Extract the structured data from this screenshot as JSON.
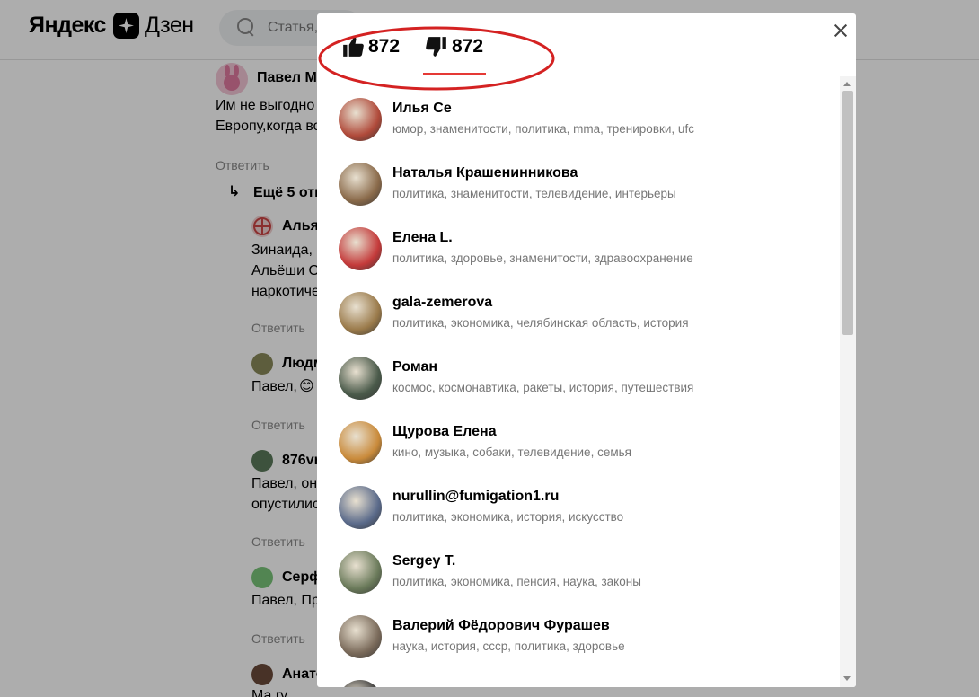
{
  "header": {
    "logo_part1": "Яндекс",
    "logo_part2": "Дзен",
    "search_placeholder": "Статья,"
  },
  "comments": {
    "c1_author": "Павел Мі",
    "c1_text_line1": "Им не выгодно",
    "c1_text_line2": "Европу,когда во",
    "c1_reply": "Ответить",
    "more_replies": "Ещё 5 отв",
    "c2_author": "Альяз",
    "c2_text_line1": "Зинаида, ",
    "c2_text_line2": "Альёши О",
    "c2_text_line3": "наркотиче",
    "c2_reply": "Ответить",
    "c3_author": "Людм",
    "c3_text": "Павел,",
    "c3_emoji": "😊",
    "c3_reply": "Ответить",
    "c4_author": "876vr",
    "c4_text_line1": "Павел, он",
    "c4_text_line2": "опустилис",
    "c4_reply": "Ответить",
    "c5_author": "Серф",
    "c5_text": "Павел, Пр",
    "c5_reply": "Ответить",
    "c6_author": "Анато",
    "c6_text": "Ма ry"
  },
  "modal": {
    "likes_count": "872",
    "dislikes_count": "872",
    "accent_color": "#e53935",
    "users": [
      {
        "name": "Илья Се",
        "tags": "юмор, знаменитости, политика, mma, тренировки, ufc",
        "avatar_color": "#b04a3a"
      },
      {
        "name": "Наталья Крашенинникова",
        "tags": "политика, знаменитости, телевидение, интерьеры",
        "avatar_color": "#8a6a4a"
      },
      {
        "name": "Елена L.",
        "tags": "политика, здоровье, знаменитости, здравоохранение",
        "avatar_color": "#c43a3a"
      },
      {
        "name": "gala-zemerova",
        "tags": "политика, экономика, челябинская область, история",
        "avatar_color": "#9a7a4a"
      },
      {
        "name": "Роман",
        "tags": "космос, космонавтика, ракеты, история, путешествия",
        "avatar_color": "#4a5a4a"
      },
      {
        "name": "Щурова Елена",
        "tags": "кино, музыка, собаки, телевидение, семья",
        "avatar_color": "#c98a3a"
      },
      {
        "name": "nurullin@fumigation1.ru",
        "tags": "политика, экономика, история, искусство",
        "avatar_color": "#5a6a8a"
      },
      {
        "name": "Sergey T.",
        "tags": "политика, экономика, пенсия, наука, законы",
        "avatar_color": "#6a7a5a"
      },
      {
        "name": "Валерий Фёдорович Фурашев",
        "tags": "наука, история, ссср, политика, здоровье",
        "avatar_color": "#7a6a5a"
      },
      {
        "name": "",
        "tags": "",
        "avatar_color": "#333333"
      }
    ]
  }
}
